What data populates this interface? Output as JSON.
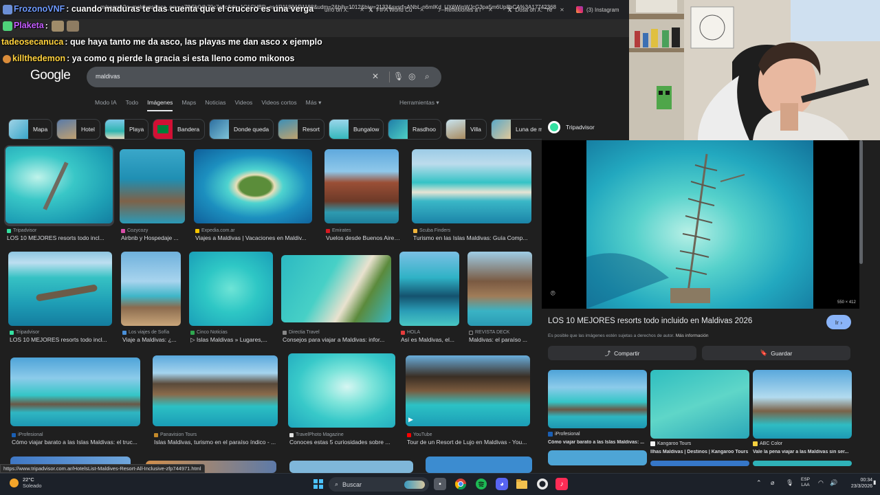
{
  "browser": {
    "tabs": [
      {
        "label": "urro on X: \"",
        "icon": "x-icon"
      },
      {
        "label": "FIFA World Cu",
        "icon": "x-icon"
      },
      {
        "label": "Reflexiones a l",
        "icon": "tiktok-icon"
      },
      {
        "label": "Dosa on X: \"Ye",
        "icon": "x-icon"
      },
      {
        "label": "(3) Instagram",
        "icon": "instagram-icon"
      }
    ],
    "url": "m/search?q=maldivas&sca_esv=a7fb5b0db70c7c6c&rlz=1C1CHBD_esAR1188AR1188&udm=2&bih=1012&biw=2133&sxsrf=ANbL-n6mIKd_UX6WinWJcG3pa5m6Up8bCA%3A17742368"
  },
  "chat": [
    {
      "user": "FrozonoVNF",
      "user_color": "#3d7bff",
      "text": ": cuando maduras te das cuenta que el crucero es una verga"
    },
    {
      "user": "Plaketa",
      "user_color": "#c45cff",
      "text": ":"
    },
    {
      "user": "tadeosecanuca",
      "user_color": "#ffd23d",
      "text": ": que haya tanto me da asco, las playas me dan asco x ejemplo"
    },
    {
      "user": "killthedemon",
      "user_color": "#ffd23d",
      "text": ": ya como q pierde la gracia si esta lleno como mikonos"
    }
  ],
  "google": {
    "logo": "Google",
    "query": "maldivas",
    "nav": [
      "Modo IA",
      "Todo",
      "Imágenes",
      "Maps",
      "Noticias",
      "Videos",
      "Videos cortos",
      "Más ▾"
    ],
    "active_nav": "Imágenes",
    "tools": "Herramientas ▾",
    "chips": [
      "Mapa",
      "Hotel",
      "Playa",
      "Bandera",
      "Donde queda",
      "Resort",
      "Bungalow",
      "Rasdhoo",
      "Villa",
      "Luna de m"
    ]
  },
  "results": [
    {
      "source": "Tripadvisor",
      "title": "LOS 10 MEJORES resorts todo incl..."
    },
    {
      "source": "Cozycozy",
      "title": "Airbnb y Hospedaje ..."
    },
    {
      "source": "Expedia.com.ar",
      "title": "Viajes a Maldivas | Vacaciones en Maldiv..."
    },
    {
      "source": "Emirates",
      "title": "Vuelos desde Buenos Aires..."
    },
    {
      "source": "Scuba Finders",
      "title": "Turismo en las Islas Maldivas: Guía Comp..."
    },
    {
      "source": "Tripadvisor",
      "title": "LOS 10 MEJORES resorts todo incl..."
    },
    {
      "source": "Los viajes de Sofía",
      "title": "Viaje a Maldivas: ¿..."
    },
    {
      "source": "Cinco Noticias",
      "title": "▷ Islas Maldivas » Lugares,..."
    },
    {
      "source": "Directia Travel",
      "title": "Consejos para viajar a Maldivas: infor..."
    },
    {
      "source": "HOLA",
      "title": "Así es Maldivas, el..."
    },
    {
      "source": "REVISTA DECK",
      "title": "Maldivas: el paraíso ..."
    },
    {
      "source": "iProfesional",
      "title": "Cómo viajar barato a las Islas Maldivas: el truc..."
    },
    {
      "source": "Panavision Tours",
      "title": "Islas Maldivas, turismo en el paraíso índico - ..."
    },
    {
      "source": "TravelPhoto Magazine",
      "title": "Conoces estas 5 curiosidades sobre ..."
    },
    {
      "source": "YouTube",
      "title": "Tour de un Resort de Lujo en Maldivas - You..."
    }
  ],
  "panel": {
    "source": "Tripadvisor",
    "dimensions": "550 × 412",
    "title": "LOS 10 MEJORES resorts todo incluido en Maldivas 2026",
    "go": "Ir ›",
    "copyright": "Es posible que las imágenes estén sujetas a derechos de autor.",
    "more_info": "Más información",
    "share": "Compartir",
    "save": "Guardar",
    "related": [
      {
        "source": "iProfesional",
        "title": "Cómo viajar barato a las Islas Maldivas: ..."
      },
      {
        "source": "Kangaroo Tours",
        "title": "Ilhas Maldivas | Destinos | Kangaroo Tours"
      },
      {
        "source": "ABC Color",
        "title": "Vale la pena viajar a las Maldivas sin ser..."
      }
    ]
  },
  "status_url": "https://www.tripadvisor.com.ar/HotelsList-Maldives-Resort-All-Inclusive-zfp744971.html",
  "taskbar": {
    "temp": "22°C",
    "weather": "Soleado",
    "search": "Buscar",
    "lang1": "ESP",
    "lang2": "LAA",
    "time": "00:34",
    "date": "23/3/2026"
  }
}
